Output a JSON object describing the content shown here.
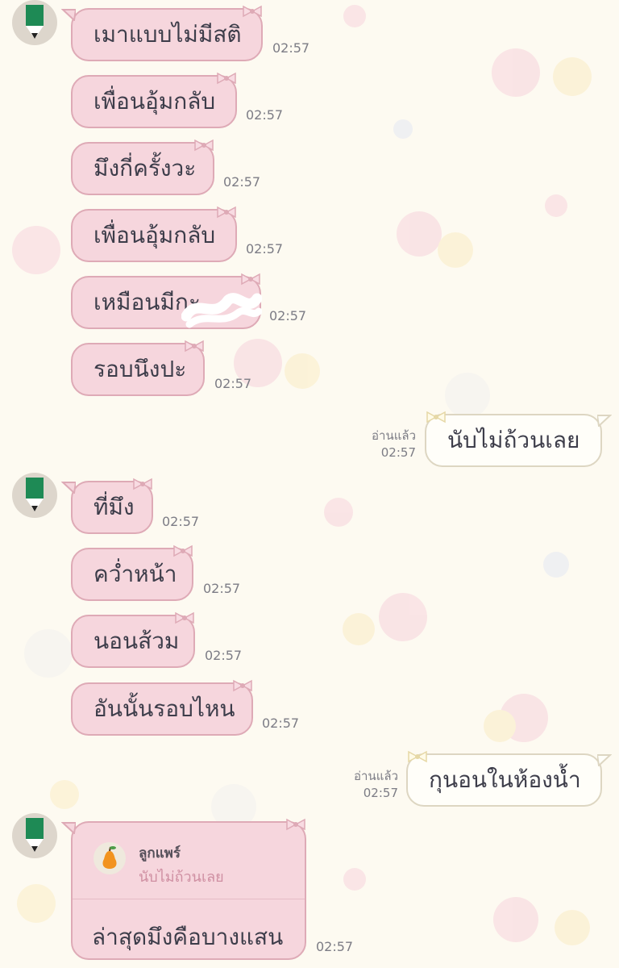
{
  "messages_in": [
    {
      "text": "เมาแบบไม่มีสติ",
      "time": "02:57"
    },
    {
      "text": "เพื่อนอุ้มกลับ",
      "time": "02:57"
    },
    {
      "text": "มึงกี่ครั้งวะ",
      "time": "02:57"
    },
    {
      "text": "เพื่อนอุ้มกลับ",
      "time": "02:57"
    },
    {
      "text": "เหมือนมีกะ",
      "time": "02:57"
    },
    {
      "text": "รอบนึงปะ",
      "time": "02:57"
    },
    {
      "text": "ที่มึง",
      "time": "02:57"
    },
    {
      "text": "คว่ำหน้า",
      "time": "02:57"
    },
    {
      "text": "นอนส้วม",
      "time": "02:57"
    },
    {
      "text": "อันนั้นรอบไหน",
      "time": "02:57"
    }
  ],
  "messages_out": [
    {
      "text": "นับไม่ถ้วนเลย",
      "read": "อ่านแล้ว",
      "time": "02:57"
    },
    {
      "text": "กุนอนในห้องน้ำ",
      "read": "อ่านแล้ว",
      "time": "02:57"
    }
  ],
  "reply": {
    "quoted_name": "ลูกแพร์",
    "quoted_text": "นับไม่ถ้วนเลย",
    "text": "ล่าสุดมึงคือบางแสน",
    "time": "02:57"
  },
  "icons": {
    "avatar": "pencil-avatar-icon",
    "bow": "bow-icon",
    "reply_avatar": "pear-icon"
  },
  "colors": {
    "background": "#fdfaf1",
    "incoming_bubble": "#f6d6dd",
    "incoming_border": "#deaab6",
    "outgoing_bubble": "#fffef9",
    "avatar_green": "#1e8a55"
  }
}
